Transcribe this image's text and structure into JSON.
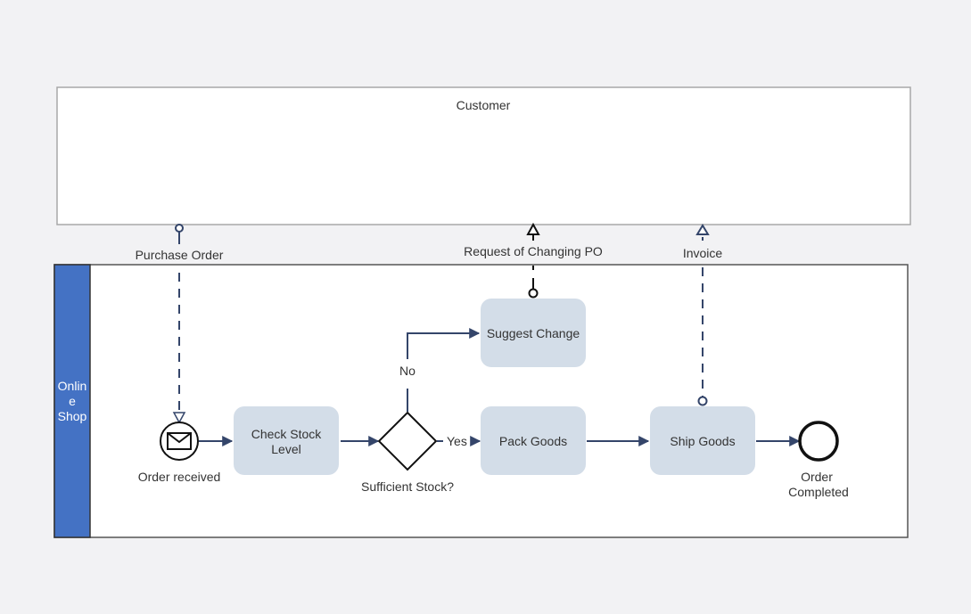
{
  "pools": {
    "customer": {
      "label": "Customer"
    },
    "shop": {
      "label_lines": [
        "Onlin",
        "e",
        "Shop"
      ],
      "lane_color": "#4472c4"
    }
  },
  "events": {
    "start": {
      "label": "Order received",
      "icon": "envelope-icon"
    },
    "end": {
      "label_lines": [
        "Order",
        "Completed"
      ]
    }
  },
  "tasks": {
    "check_stock": {
      "label_lines": [
        "Check Stock",
        "Level"
      ]
    },
    "suggest_change": {
      "label": "Suggest Change"
    },
    "pack_goods": {
      "label": "Pack Goods"
    },
    "ship_goods": {
      "label": "Ship Goods"
    }
  },
  "gateway": {
    "label": "Sufficient Stock?",
    "yes": "Yes",
    "no": "No"
  },
  "messages": {
    "purchase_order": "Purchase Order",
    "change_request": "Request of Changing PO",
    "invoice": "Invoice"
  },
  "colors": {
    "task_fill": "#d3dde8",
    "flow": "#34456a",
    "background": "#f2f2f4"
  }
}
